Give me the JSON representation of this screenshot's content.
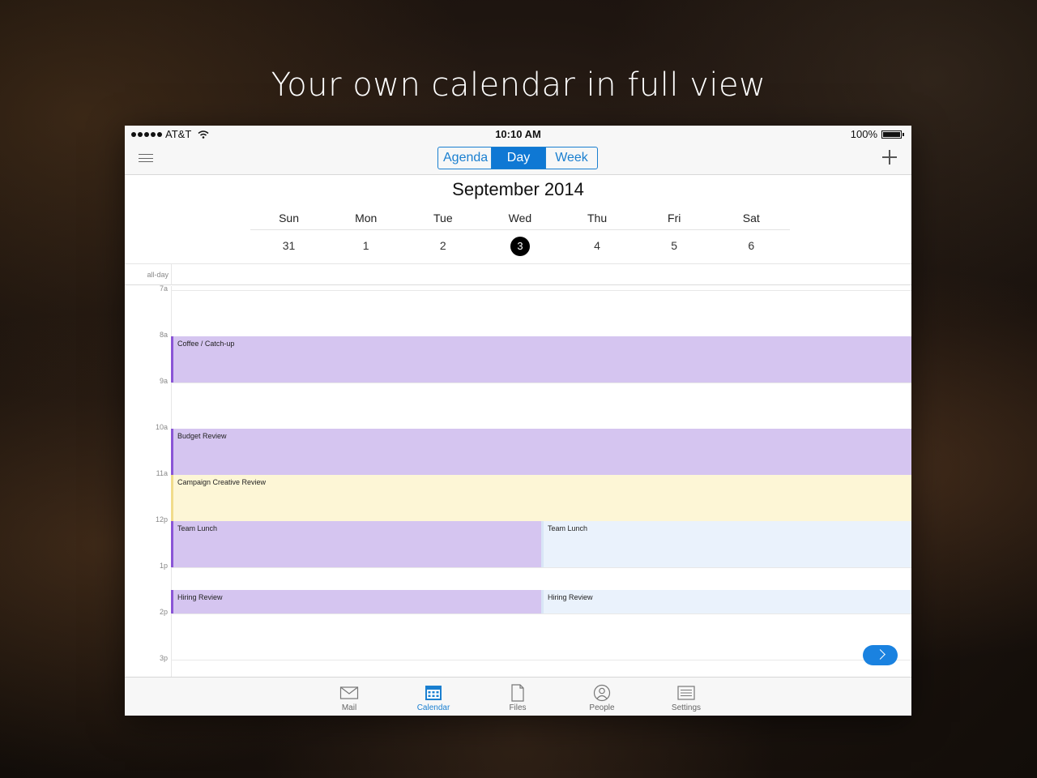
{
  "headline": "Your own calendar in full view",
  "status_bar": {
    "carrier": "AT&T",
    "time": "10:10 AM",
    "battery": "100%"
  },
  "toolbar": {
    "segments": [
      "Agenda",
      "Day",
      "Week"
    ],
    "selected_segment": "Day"
  },
  "calendar": {
    "month_title": "September 2014",
    "day_names": [
      "Sun",
      "Mon",
      "Tue",
      "Wed",
      "Thu",
      "Fri",
      "Sat"
    ],
    "day_numbers": [
      "31",
      "1",
      "2",
      "3",
      "4",
      "5",
      "6"
    ],
    "selected_day": "3",
    "all_day_label": "all-day",
    "hours": [
      "7a",
      "8a",
      "9a",
      "10a",
      "11a",
      "12p",
      "1p",
      "2p",
      "3p"
    ],
    "events": [
      {
        "title": "Coffee / Catch-up",
        "color": "#d5c5f0"
      },
      {
        "title": "Budget Review",
        "color": "#d5c5f0"
      },
      {
        "title": "Campaign Creative Review",
        "color": "#fdf6d6"
      },
      {
        "title": "Team Lunch",
        "color": "#d5c5f0"
      },
      {
        "title": "Team Lunch",
        "color": "#eaf2fc"
      },
      {
        "title": "Hiring Review",
        "color": "#d5c5f0"
      },
      {
        "title": "Hiring Review",
        "color": "#eaf2fc"
      }
    ]
  },
  "tabbar": {
    "tabs": [
      {
        "label": "Mail",
        "icon": "mail-icon"
      },
      {
        "label": "Calendar",
        "icon": "calendar-icon"
      },
      {
        "label": "Files",
        "icon": "file-icon"
      },
      {
        "label": "People",
        "icon": "people-icon"
      },
      {
        "label": "Settings",
        "icon": "settings-icon"
      }
    ],
    "active": "Calendar"
  },
  "colors": {
    "accent": "#0f78d4",
    "event_purple": "#d5c5f0",
    "event_purple_border": "#8a55d6",
    "event_yellow": "#fdf6d6",
    "event_blue": "#eaf2fc"
  }
}
